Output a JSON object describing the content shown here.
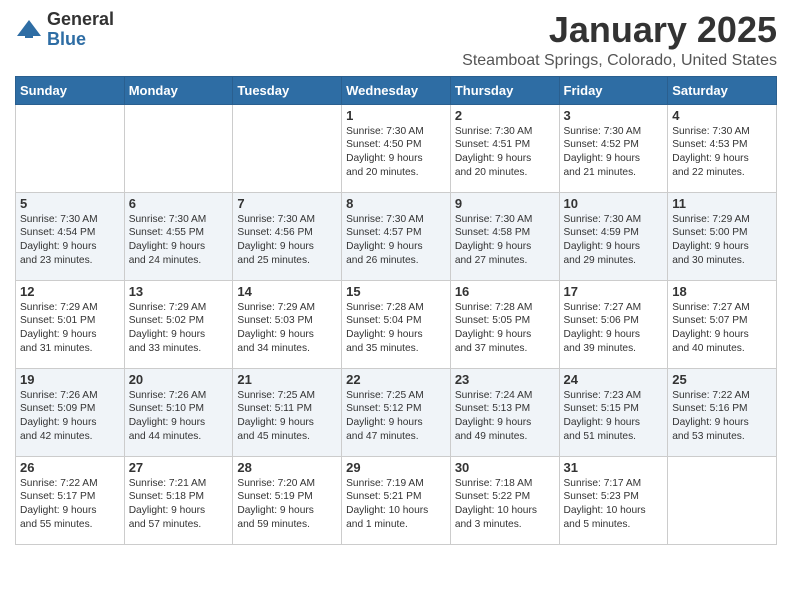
{
  "logo": {
    "general": "General",
    "blue": "Blue"
  },
  "header": {
    "month": "January 2025",
    "location": "Steamboat Springs, Colorado, United States"
  },
  "weekdays": [
    "Sunday",
    "Monday",
    "Tuesday",
    "Wednesday",
    "Thursday",
    "Friday",
    "Saturday"
  ],
  "weeks": [
    [
      {
        "day": "",
        "info": ""
      },
      {
        "day": "",
        "info": ""
      },
      {
        "day": "",
        "info": ""
      },
      {
        "day": "1",
        "info": "Sunrise: 7:30 AM\nSunset: 4:50 PM\nDaylight: 9 hours\nand 20 minutes."
      },
      {
        "day": "2",
        "info": "Sunrise: 7:30 AM\nSunset: 4:51 PM\nDaylight: 9 hours\nand 20 minutes."
      },
      {
        "day": "3",
        "info": "Sunrise: 7:30 AM\nSunset: 4:52 PM\nDaylight: 9 hours\nand 21 minutes."
      },
      {
        "day": "4",
        "info": "Sunrise: 7:30 AM\nSunset: 4:53 PM\nDaylight: 9 hours\nand 22 minutes."
      }
    ],
    [
      {
        "day": "5",
        "info": "Sunrise: 7:30 AM\nSunset: 4:54 PM\nDaylight: 9 hours\nand 23 minutes."
      },
      {
        "day": "6",
        "info": "Sunrise: 7:30 AM\nSunset: 4:55 PM\nDaylight: 9 hours\nand 24 minutes."
      },
      {
        "day": "7",
        "info": "Sunrise: 7:30 AM\nSunset: 4:56 PM\nDaylight: 9 hours\nand 25 minutes."
      },
      {
        "day": "8",
        "info": "Sunrise: 7:30 AM\nSunset: 4:57 PM\nDaylight: 9 hours\nand 26 minutes."
      },
      {
        "day": "9",
        "info": "Sunrise: 7:30 AM\nSunset: 4:58 PM\nDaylight: 9 hours\nand 27 minutes."
      },
      {
        "day": "10",
        "info": "Sunrise: 7:30 AM\nSunset: 4:59 PM\nDaylight: 9 hours\nand 29 minutes."
      },
      {
        "day": "11",
        "info": "Sunrise: 7:29 AM\nSunset: 5:00 PM\nDaylight: 9 hours\nand 30 minutes."
      }
    ],
    [
      {
        "day": "12",
        "info": "Sunrise: 7:29 AM\nSunset: 5:01 PM\nDaylight: 9 hours\nand 31 minutes."
      },
      {
        "day": "13",
        "info": "Sunrise: 7:29 AM\nSunset: 5:02 PM\nDaylight: 9 hours\nand 33 minutes."
      },
      {
        "day": "14",
        "info": "Sunrise: 7:29 AM\nSunset: 5:03 PM\nDaylight: 9 hours\nand 34 minutes."
      },
      {
        "day": "15",
        "info": "Sunrise: 7:28 AM\nSunset: 5:04 PM\nDaylight: 9 hours\nand 35 minutes."
      },
      {
        "day": "16",
        "info": "Sunrise: 7:28 AM\nSunset: 5:05 PM\nDaylight: 9 hours\nand 37 minutes."
      },
      {
        "day": "17",
        "info": "Sunrise: 7:27 AM\nSunset: 5:06 PM\nDaylight: 9 hours\nand 39 minutes."
      },
      {
        "day": "18",
        "info": "Sunrise: 7:27 AM\nSunset: 5:07 PM\nDaylight: 9 hours\nand 40 minutes."
      }
    ],
    [
      {
        "day": "19",
        "info": "Sunrise: 7:26 AM\nSunset: 5:09 PM\nDaylight: 9 hours\nand 42 minutes."
      },
      {
        "day": "20",
        "info": "Sunrise: 7:26 AM\nSunset: 5:10 PM\nDaylight: 9 hours\nand 44 minutes."
      },
      {
        "day": "21",
        "info": "Sunrise: 7:25 AM\nSunset: 5:11 PM\nDaylight: 9 hours\nand 45 minutes."
      },
      {
        "day": "22",
        "info": "Sunrise: 7:25 AM\nSunset: 5:12 PM\nDaylight: 9 hours\nand 47 minutes."
      },
      {
        "day": "23",
        "info": "Sunrise: 7:24 AM\nSunset: 5:13 PM\nDaylight: 9 hours\nand 49 minutes."
      },
      {
        "day": "24",
        "info": "Sunrise: 7:23 AM\nSunset: 5:15 PM\nDaylight: 9 hours\nand 51 minutes."
      },
      {
        "day": "25",
        "info": "Sunrise: 7:22 AM\nSunset: 5:16 PM\nDaylight: 9 hours\nand 53 minutes."
      }
    ],
    [
      {
        "day": "26",
        "info": "Sunrise: 7:22 AM\nSunset: 5:17 PM\nDaylight: 9 hours\nand 55 minutes."
      },
      {
        "day": "27",
        "info": "Sunrise: 7:21 AM\nSunset: 5:18 PM\nDaylight: 9 hours\nand 57 minutes."
      },
      {
        "day": "28",
        "info": "Sunrise: 7:20 AM\nSunset: 5:19 PM\nDaylight: 9 hours\nand 59 minutes."
      },
      {
        "day": "29",
        "info": "Sunrise: 7:19 AM\nSunset: 5:21 PM\nDaylight: 10 hours\nand 1 minute."
      },
      {
        "day": "30",
        "info": "Sunrise: 7:18 AM\nSunset: 5:22 PM\nDaylight: 10 hours\nand 3 minutes."
      },
      {
        "day": "31",
        "info": "Sunrise: 7:17 AM\nSunset: 5:23 PM\nDaylight: 10 hours\nand 5 minutes."
      },
      {
        "day": "",
        "info": ""
      }
    ]
  ]
}
